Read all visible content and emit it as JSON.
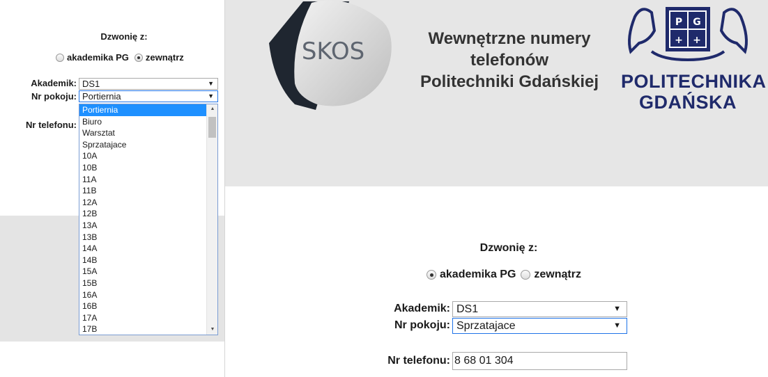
{
  "small_form": {
    "title": "Dzwonię z:",
    "radio_academy": "akademika PG",
    "radio_outside": "zewnątrz",
    "akademik_label": "Akademik:",
    "akademik_value": "DS1",
    "room_label": "Nr pokoju:",
    "room_value": "Portiernia",
    "phone_label": "Nr telefonu:",
    "dropdown_options": [
      "Portiernia",
      "Biuro",
      "Warsztat",
      "Sprzatajace",
      "10A",
      "10B",
      "11A",
      "11B",
      "12A",
      "12B",
      "13A",
      "13B",
      "14A",
      "14B",
      "15A",
      "15B",
      "16A",
      "16B",
      "17A",
      "17B"
    ],
    "selected_option": "Portiernia"
  },
  "header": {
    "skos_logo_text": "SKOS",
    "title_line1": "Wewnętrzne numery",
    "title_line2": "telefonów",
    "title_line3": "Politechniki Gdańskiej",
    "pg_logo_line1": "POLITECHNIKA",
    "pg_logo_line2": "GDAŃSKA",
    "pg_crest_text": "PG"
  },
  "main_form": {
    "title": "Dzwonię z:",
    "radio_academy": "akademika PG",
    "radio_outside": "zewnątrz",
    "akademik_label": "Akademik:",
    "akademik_value": "DS1",
    "room_label": "Nr pokoju:",
    "room_value": "Sprzatajace",
    "phone_label": "Nr telefonu:",
    "phone_value": "8 68 01 304"
  },
  "colors": {
    "brand_navy": "#1f2a6b",
    "selection_blue": "#1e90ff",
    "header_bg": "#e6e6e6"
  }
}
